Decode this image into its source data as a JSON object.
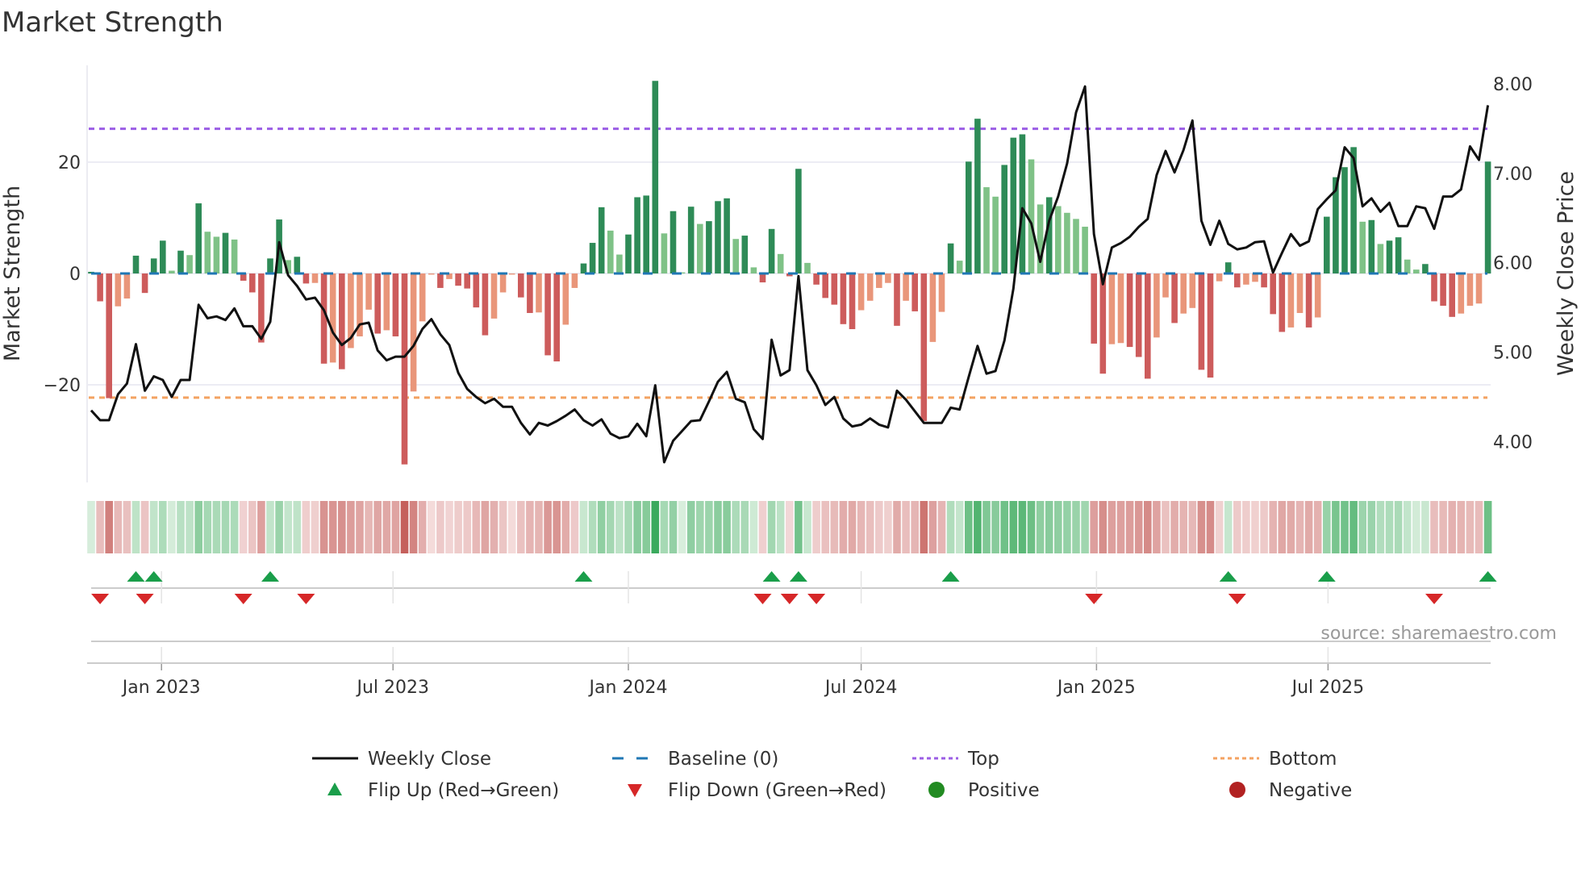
{
  "chart_data": {
    "type": "bar+line",
    "title": "Market Strength",
    "ylabel_left": "Market Strength",
    "ylabel_right": "Weekly Close Price",
    "left_ticks": [
      {
        "value": 20,
        "label": "20"
      },
      {
        "value": 0,
        "label": "0"
      },
      {
        "value": -20,
        "label": "−20"
      }
    ],
    "right_ticks": [
      {
        "value": 8,
        "label": "8.00"
      },
      {
        "value": 7,
        "label": "7.00"
      },
      {
        "value": 6,
        "label": "6.00"
      },
      {
        "value": 5,
        "label": "5.00"
      },
      {
        "value": 4,
        "label": "4.00"
      }
    ],
    "ylim_left": [
      -37.5,
      37.5
    ],
    "ylim_right": [
      3.55,
      8.2
    ],
    "start_date": "2022-11-07",
    "frequency": "weekly",
    "x_ticks": [
      {
        "date": "2023-01-01",
        "label": "Jan 2023"
      },
      {
        "date": "2023-07-01",
        "label": "Jul 2023"
      },
      {
        "date": "2024-01-01",
        "label": "Jan 2024"
      },
      {
        "date": "2024-07-01",
        "label": "Jul 2024"
      },
      {
        "date": "2025-01-01",
        "label": "Jan 2025"
      },
      {
        "date": "2025-07-01",
        "label": "Jul 2025"
      }
    ],
    "top_level": 26.0,
    "bottom_level": -22.3,
    "baseline": 0,
    "strength": [
      0.3,
      -5.0,
      -22.4,
      -5.9,
      -4.5,
      3.2,
      -3.5,
      2.7,
      5.9,
      0.5,
      4.1,
      3.3,
      12.6,
      7.5,
      6.6,
      7.3,
      6.1,
      -1.3,
      -3.4,
      -12.4,
      2.7,
      9.7,
      2.4,
      3.0,
      -1.8,
      -1.7,
      -16.2,
      -16.0,
      -17.2,
      -13.4,
      -11.3,
      -6.5,
      -10.8,
      -10.2,
      -11.3,
      -34.3,
      -21.2,
      -8.6,
      -0.2,
      -2.6,
      -1.0,
      -2.2,
      -2.7,
      -6.1,
      -11.1,
      -8.1,
      -3.4,
      -0.2,
      -4.3,
      -7.1,
      -7.0,
      -14.7,
      -15.8,
      -9.2,
      -2.6,
      1.8,
      5.5,
      11.9,
      7.7,
      3.4,
      7.0,
      13.7,
      14.0,
      34.6,
      7.2,
      11.2,
      0.2,
      12.0,
      8.9,
      9.4,
      13.0,
      13.5,
      6.2,
      6.8,
      1.1,
      -1.6,
      8.0,
      3.5,
      -0.5,
      18.8,
      1.9,
      -2.0,
      -4.4,
      -5.6,
      -9.1,
      -10.0,
      -6.6,
      -4.9,
      -2.6,
      -1.7,
      -9.4,
      -4.9,
      -6.8,
      -26.5,
      -12.3,
      -6.9,
      5.4,
      2.3,
      20.1,
      27.8,
      15.5,
      13.8,
      19.5,
      24.4,
      25.0,
      20.5,
      12.4,
      13.7,
      12.1,
      10.9,
      9.8,
      8.4,
      -12.6,
      -18.0,
      -12.7,
      -12.5,
      -13.2,
      -15.0,
      -18.9,
      -11.5,
      -4.3,
      -8.9,
      -7.2,
      -6.2,
      -17.3,
      -18.7,
      -1.4,
      2.0,
      -2.5,
      -2.0,
      -1.5,
      -2.5,
      -7.3,
      -10.5,
      -9.7,
      -7.1,
      -9.7,
      -7.9,
      10.2,
      17.3,
      19.1,
      22.7,
      9.3,
      9.6,
      5.3,
      5.9,
      6.5,
      2.5,
      0.7,
      1.7,
      -5.0,
      -5.8,
      -7.8,
      -7.2,
      -5.8,
      -5.4,
      20.1
    ],
    "weekly_close": [
      4.35,
      4.24,
      4.24,
      4.53,
      4.65,
      5.09,
      4.57,
      4.73,
      4.69,
      4.5,
      4.69,
      4.69,
      5.53,
      5.38,
      5.4,
      5.36,
      5.49,
      5.29,
      5.29,
      5.15,
      5.34,
      6.23,
      5.86,
      5.74,
      5.59,
      5.61,
      5.47,
      5.22,
      5.08,
      5.16,
      5.31,
      5.33,
      5.02,
      4.91,
      4.95,
      4.95,
      5.07,
      5.26,
      5.37,
      5.2,
      5.08,
      4.77,
      4.59,
      4.5,
      4.43,
      4.48,
      4.39,
      4.39,
      4.21,
      4.08,
      4.21,
      4.18,
      4.23,
      4.29,
      4.36,
      4.24,
      4.18,
      4.25,
      4.09,
      4.04,
      4.06,
      4.2,
      4.06,
      4.63,
      3.77,
      4.01,
      4.12,
      4.23,
      4.24,
      4.45,
      4.67,
      4.78,
      4.48,
      4.44,
      4.14,
      4.03,
      5.14,
      4.74,
      4.8,
      5.85,
      4.8,
      4.63,
      4.41,
      4.5,
      4.26,
      4.17,
      4.19,
      4.26,
      4.19,
      4.16,
      4.57,
      4.47,
      4.34,
      4.21,
      4.21,
      4.21,
      4.38,
      4.36,
      4.72,
      5.07,
      4.76,
      4.79,
      5.13,
      5.71,
      6.61,
      6.44,
      6.01,
      6.47,
      6.74,
      7.11,
      7.68,
      7.97,
      6.32,
      5.76,
      6.17,
      6.22,
      6.29,
      6.4,
      6.49,
      6.98,
      7.25,
      7.01,
      7.26,
      7.59,
      6.47,
      6.2,
      6.47,
      6.21,
      6.15,
      6.17,
      6.23,
      6.24,
      5.89,
      6.11,
      6.32,
      6.19,
      6.24,
      6.6,
      6.71,
      6.81,
      7.29,
      7.17,
      6.63,
      6.72,
      6.57,
      6.67,
      6.41,
      6.41,
      6.63,
      6.61,
      6.38,
      6.74,
      6.74,
      6.82,
      7.3,
      7.15,
      7.76
    ],
    "flip_up_weeks": [
      5,
      7,
      20,
      55,
      76,
      79,
      96,
      127,
      138,
      156
    ],
    "flip_down_weeks": [
      1,
      6,
      17,
      24,
      75,
      78,
      81,
      112,
      128,
      150
    ],
    "colors": {
      "strong_up": "#2e8b57",
      "weak_up": "#7fc287",
      "strong_down": "#cd5c5c",
      "weak_down": "#e9967a",
      "line": "#111111",
      "baseline": "#1f77b4",
      "top": "#9b5de5",
      "bottom": "#f4a261",
      "flip_up": "#1a9e4a",
      "flip_down": "#d62728",
      "positive": "#228b22",
      "negative": "#b22222"
    },
    "legend": {
      "placement": "bottom-center",
      "items": [
        {
          "key": "line",
          "label": "Weekly Close"
        },
        {
          "key": "baseline",
          "label": "Baseline (0)"
        },
        {
          "key": "top",
          "label": "Top"
        },
        {
          "key": "bottom",
          "label": "Bottom"
        },
        {
          "key": "flip_up",
          "label": "Flip Up (Red→Green)"
        },
        {
          "key": "flip_down",
          "label": "Flip Down (Green→Red)"
        },
        {
          "key": "positive",
          "label": "Positive"
        },
        {
          "key": "negative",
          "label": "Negative"
        }
      ]
    },
    "source": "source: sharemaestro.com"
  }
}
